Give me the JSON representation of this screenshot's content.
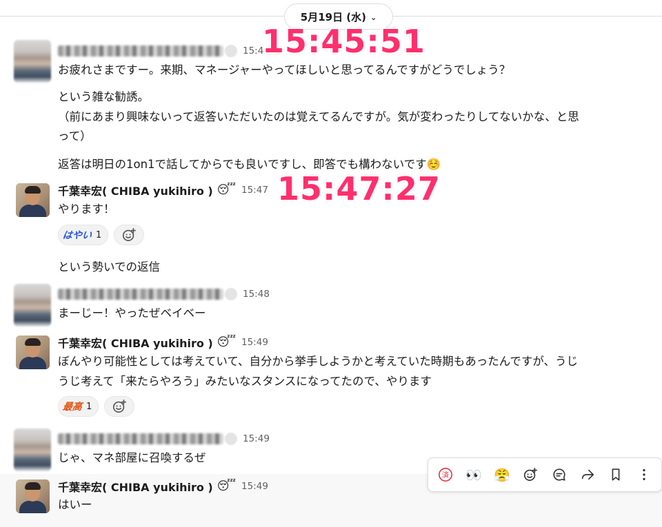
{
  "date_divider": {
    "label": "5月19日 (水)"
  },
  "overlays": {
    "first": "15:45:51",
    "second": "15:47:27"
  },
  "messages": [
    {
      "sender": "",
      "time": "15:45",
      "lines": [
        "お疲れさまですー。来期、マネージャーやってほしいと思ってるんですがどうでしょう？",
        "という雑な勧誘。",
        "（前にあまり興味ないって返答いただいたのは覚えてるんですが。気が変わったりしてないかな、と思",
        "って）",
        "返答は明日の1on1で話してからでも良いですし、即答でも構わないです☺️"
      ]
    },
    {
      "sender": "千葉幸宏( CHIBA yukihiro )",
      "status_emoji": "😴",
      "time": "15:47",
      "lines": [
        "やります！"
      ],
      "reaction": {
        "stamp": "はやい",
        "count": "1"
      }
    },
    {
      "lines": [
        "という勢いでの返信"
      ]
    },
    {
      "sender": "",
      "time": "15:48",
      "lines": [
        "まーじー！やったぜベイベー"
      ]
    },
    {
      "sender": "千葉幸宏( CHIBA yukihiro )",
      "status_emoji": "😴",
      "time": "15:49",
      "lines": [
        "ぼんやり可能性としては考えていて、自分から挙手しようかと考えていた時期もあったんですが、うじ",
        "うじ考えて「来たらやろう」みたいなスタンスになってたので、やります"
      ],
      "reaction": {
        "stamp": "最高",
        "count": "1"
      }
    },
    {
      "sender": "",
      "time": "15:49",
      "lines": [
        "じゃ、マネ部屋に召喚するぜ"
      ]
    },
    {
      "sender": "千葉幸宏( CHIBA yukihiro )",
      "status_emoji": "😴",
      "time": "15:49",
      "lines": [
        "はいー"
      ]
    }
  ],
  "toolbar": {
    "done_stamp": "済",
    "eyes": "👀",
    "hot_face": "😤"
  },
  "colors": {
    "overlay": "#ff2f6d",
    "link_blue": "#2a58d9",
    "stamp_orange": "#e2530f"
  }
}
